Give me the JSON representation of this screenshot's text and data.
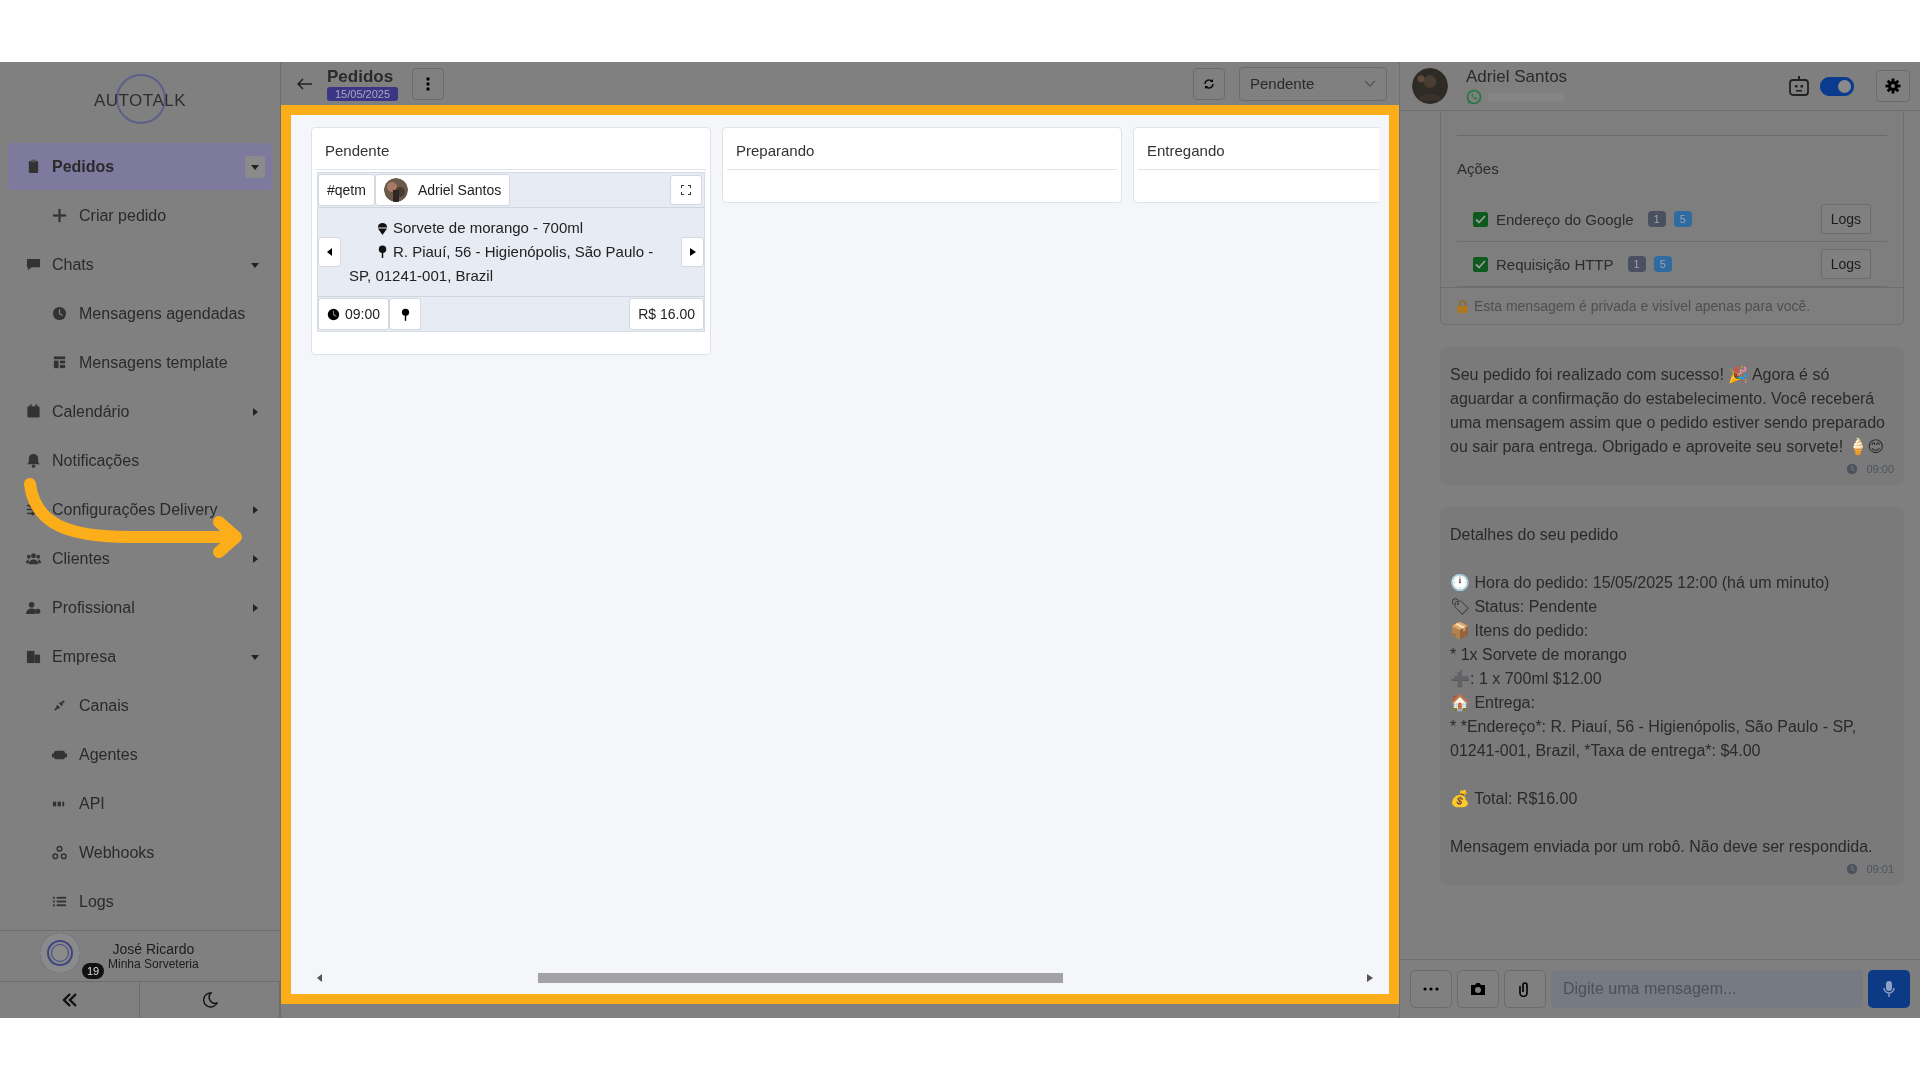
{
  "sidebar": {
    "logo": "AUTOTALK",
    "items": [
      {
        "label": "Pedidos",
        "selected": true,
        "expanded": true,
        "children": [
          {
            "label": "Criar pedido",
            "selected": false
          }
        ]
      },
      {
        "label": "Chats",
        "selected": false,
        "expanded": true,
        "children": [
          {
            "label": "Mensagens agendadas",
            "selected": false
          },
          {
            "label": "Mensagens template",
            "selected": false
          }
        ]
      },
      {
        "label": "Calendário",
        "selected": false,
        "expanded": false
      },
      {
        "label": "Notificações",
        "selected": false
      },
      {
        "label": "Configurações Delivery",
        "selected": false,
        "expanded": false
      },
      {
        "label": "Clientes",
        "selected": false,
        "expanded": false
      },
      {
        "label": "Profissional",
        "selected": false,
        "expanded": false
      },
      {
        "label": "Empresa",
        "selected": false,
        "expanded": true,
        "children": [
          {
            "label": "Canais",
            "selected": false
          },
          {
            "label": "Agentes",
            "selected": false
          },
          {
            "label": "API",
            "selected": false
          },
          {
            "label": "Webhooks",
            "selected": false
          },
          {
            "label": "Logs",
            "selected": false
          }
        ]
      }
    ],
    "user": {
      "name": "José Ricardo",
      "company": "Minha Sorveteria",
      "badge": "19"
    }
  },
  "header": {
    "title": "Pedidos",
    "date": "15/05/2025",
    "status_select": "Pendente"
  },
  "board": {
    "columns": [
      {
        "title": "Pendente",
        "cards": [
          {
            "code": "#qetm",
            "customer": "Adriel Santos",
            "item": "Sorvete de morango - 700ml",
            "address": "R. Piauí, 56 - Higienópolis, São Paulo - SP, 01241-001, Brazil",
            "time": "09:00",
            "price": "R$ 16.00"
          }
        ]
      },
      {
        "title": "Preparando"
      },
      {
        "title": "Entregando"
      }
    ]
  },
  "chat": {
    "contact": "Adriel Santos",
    "bot_enabled": true,
    "actions": {
      "title": "Ações",
      "rows": [
        {
          "label": "Endereço do Google",
          "checked": true,
          "badges": [
            {
              "text": "1",
              "color": "#4b5060"
            },
            {
              "text": "5",
              "color": "#2f6aa0"
            }
          ],
          "button": "Logs"
        },
        {
          "label": "Requisição HTTP",
          "checked": true,
          "badges": [
            {
              "text": "1",
              "color": "#4b5060"
            },
            {
              "text": "5",
              "color": "#2f6aa0"
            }
          ],
          "button": "Logs"
        }
      ],
      "note": "Esta mensagem é privada e visível apenas para você."
    },
    "messages": [
      {
        "text": "Seu pedido foi realizado com sucesso! 🎉 Agora é só aguardar a confirmação do estabelecimento. Você receberá uma mensagem assim que o pedido estiver sendo preparado ou sair para entrega. Obrigado e aproveite seu sorvete! 🍦😊",
        "time": "09:00"
      },
      {
        "text": "Detalhes do seu pedido\n\n🕛 Hora do pedido: 15/05/2025 12:00 (há um minuto)\n🏷 Status: Pendente\n📦 Itens do pedido:\n* 1x Sorvete de morango\n➕: 1 x 700ml $12.00\n🏠 Entrega:\n* *Endereço*: R. Piauí, 56 - Higienópolis, São Paulo - SP, 01241-001, Brazil, *Taxa de entrega*: $4.00\n\n💰 Total: R$16.00\n\nMensagem enviada por um robô. Não deve ser respondida.",
        "time": "09:01"
      }
    ],
    "input": {
      "placeholder": "Digite uma mensagem..."
    }
  }
}
